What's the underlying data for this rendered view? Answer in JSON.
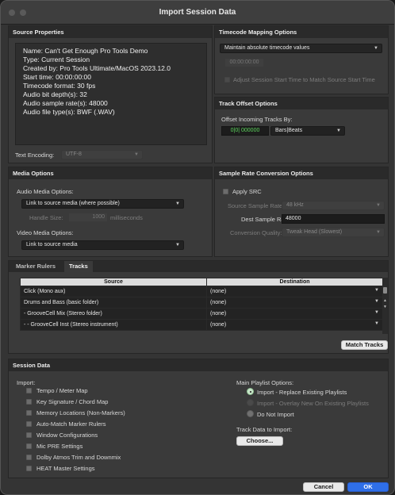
{
  "window": {
    "title": "Import Session Data"
  },
  "source_properties": {
    "heading": "Source Properties",
    "lines": [
      "Name: Can't Get Enough Pro Tools Demo",
      "Type: Current Session",
      "Created by: Pro Tools Ultimate/MacOS 2023.12.0",
      "Start time: 00:00:00:00",
      "Timecode format: 30 fps",
      "Audio bit depth(s): 32",
      "Audio sample rate(s): 48000",
      "Audio file type(s): BWF (.WAV)"
    ],
    "text_encoding_label": "Text Encoding:",
    "text_encoding_value": "UTF-8"
  },
  "timecode_mapping": {
    "heading": "Timecode Mapping Options",
    "mode": "Maintain absolute timecode values",
    "timecode": "00:00:00:00",
    "adjust_label": "Adjust Session Start Time to Match Source Start Time"
  },
  "track_offset": {
    "heading": "Track Offset Options",
    "label": "Offset Incoming Tracks By:",
    "value": "0|0| 000000",
    "unit": "Bars|Beats"
  },
  "media_options": {
    "heading": "Media Options",
    "audio_label": "Audio Media Options:",
    "audio_value": "Link to source media (where possible)",
    "handle_label": "Handle Size:",
    "handle_value": "1000",
    "handle_unit": "milliseconds",
    "video_label": "Video Media Options:",
    "video_value": "Link to source media"
  },
  "src_options": {
    "heading": "Sample Rate Conversion Options",
    "apply_label": "Apply SRC",
    "source_rate_label": "Source Sample Rate:",
    "source_rate_value": "48 kHz",
    "dest_rate_label": "Dest Sample Rate:",
    "dest_rate_value": "48000",
    "quality_label": "Conversion Quality:",
    "quality_value": "Tweak Head (Slowest)"
  },
  "tracks": {
    "tabs": [
      "Marker Rulers",
      "Tracks"
    ],
    "columns": [
      "Source",
      "Destination"
    ],
    "rows": [
      {
        "source": "Click (Mono aux)",
        "destination": "(none)"
      },
      {
        "source": "Drums and Bass (basic folder)",
        "destination": "(none)"
      },
      {
        "source": "- GrooveCell Mix (Stereo folder)",
        "destination": "(none)"
      },
      {
        "source": "- - GrooveCell Inst (Stereo instrument)",
        "destination": "(none)"
      }
    ],
    "match_label": "Match Tracks"
  },
  "session_data": {
    "heading": "Session Data",
    "import_label": "Import:",
    "items": [
      "Tempo / Meter Map",
      "Key Signature / Chord Map",
      "Memory Locations (Non-Markers)",
      "Auto-Match Marker Rulers",
      "Window Configurations",
      "Mic PRE Settings",
      "Dolby Atmos Trim and Downmix",
      "HEAT Master Settings"
    ],
    "playlist_label": "Main Playlist Options:",
    "playlist_options": [
      "Import - Replace Existing Playlists",
      "Import - Overlay New On Existing Playlists",
      "Do Not Import"
    ],
    "track_data_label": "Track Data to Import:",
    "choose_label": "Choose..."
  },
  "footer": {
    "cancel_label": "Cancel",
    "ok_label": "OK"
  },
  "colors": {
    "accent": "#2f6fe8",
    "timecode_green": "#5dd65d"
  }
}
